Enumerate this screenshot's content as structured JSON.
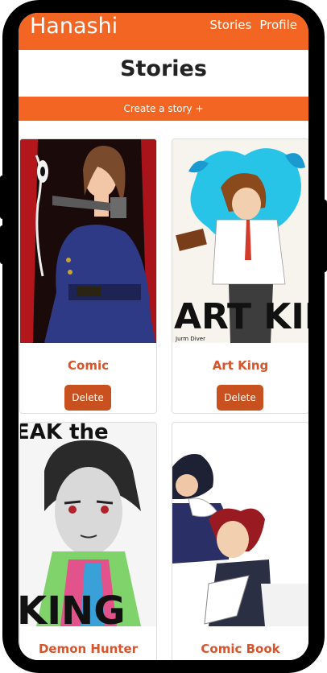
{
  "navbar": {
    "brand": "Hanashi",
    "links": [
      "Stories",
      "Profile"
    ]
  },
  "page": {
    "title": "Stories",
    "create_label": "Create a story +"
  },
  "stories": [
    {
      "title": "Comic",
      "delete_label": "Delete",
      "cover_text": ""
    },
    {
      "title": "Art King",
      "delete_label": "Delete",
      "cover_text": "ART KING",
      "cover_credit": "Jurm Diver"
    },
    {
      "title": "Demon Hunter",
      "cover_text_top": "EAK the",
      "cover_text_bottom": "KING"
    },
    {
      "title": "Comic Book"
    }
  ],
  "colors": {
    "accent": "#f26522",
    "delete": "#c9501f",
    "title": "#d9532b"
  }
}
